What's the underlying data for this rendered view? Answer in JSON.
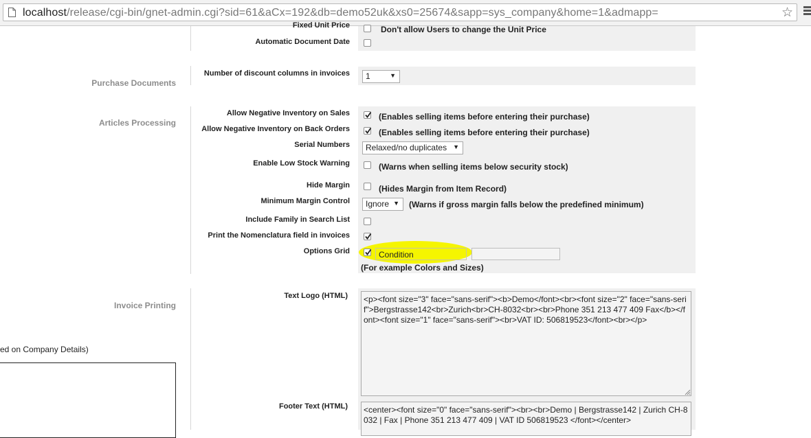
{
  "browser": {
    "url_host": "localhost",
    "url_path": "/release/cgi-bin/gnet-admin.cgi?sid=61&aCx=192&db=demo52uk&xs0=25674&sapp=sys_company&home=1&admapp="
  },
  "top_rows": {
    "fixed_unit_price_label": "Fixed Unit Price",
    "fixed_unit_price_desc": "Don't allow Users to change the Unit Price",
    "automatic_document_date_label": "Automatic Document Date"
  },
  "purchase_documents": {
    "section_title": "Purchase Documents",
    "discount_columns_label": "Number of discount columns in invoices",
    "discount_columns_value": "1"
  },
  "articles_processing": {
    "section_title": "Articles Processing",
    "neg_inventory_sales_label": "Allow Negative Inventory on Sales",
    "neg_inventory_sales_desc": "(Enables selling items before entering their purchase)",
    "neg_inventory_back_orders_label": "Allow Negative Inventory on Back Orders",
    "neg_inventory_back_orders_desc": "(Enables selling items before entering their purchase)",
    "serial_numbers_label": "Serial Numbers",
    "serial_numbers_value": "Relaxed/no duplicates",
    "low_stock_warning_label": "Enable Low Stock Warning",
    "low_stock_warning_desc": "(Warns when selling items below security stock)",
    "hide_margin_label": "Hide Margin",
    "hide_margin_desc": "(Hides Margin from Item Record)",
    "min_margin_control_label": "Minimum Margin Control",
    "min_margin_control_value": "Ignore",
    "min_margin_control_desc": "(Warns if gross margin falls below the predefined minimum)",
    "include_family_label": "Include Family in Search List",
    "print_nomenclatura_label": "Print the Nomenclatura field in invoices",
    "options_grid_label": "Options Grid",
    "options_grid_value1": "Condition",
    "options_grid_value2": "",
    "options_grid_note": "(For example Colors and Sizes)"
  },
  "invoice_printing": {
    "section_title": "Invoice Printing",
    "partial_note": "ed on Company Details)",
    "text_logo_label": "Text Logo (HTML)",
    "text_logo_value": "<p><font size=\"3\" face=\"sans-serif\"><b>Demo</font><br><font size=\"2\" face=\"sans-serif\">Bergstrasse142<br>Zurich<br>CH-8032<br><br>Phone 351 213 477 409 Fax</b></font><font size=\"1\" face=\"sans-serif\"><br>VAT ID: 506819523</font><br></p>",
    "footer_text_label": "Footer Text (HTML)",
    "footer_text_value": "<center><font size=\"0\" face=\"sans-serif\"><br><br>Demo | Bergstrasse142 |  Zurich CH-8032  | Fax  | Phone 351 213 477 409  | VAT ID 506819523 </font></center>"
  },
  "colors": {
    "highlight": "#f5f500",
    "panel_bg": "#f0f0f0",
    "section_label": "#8d8d8d"
  }
}
